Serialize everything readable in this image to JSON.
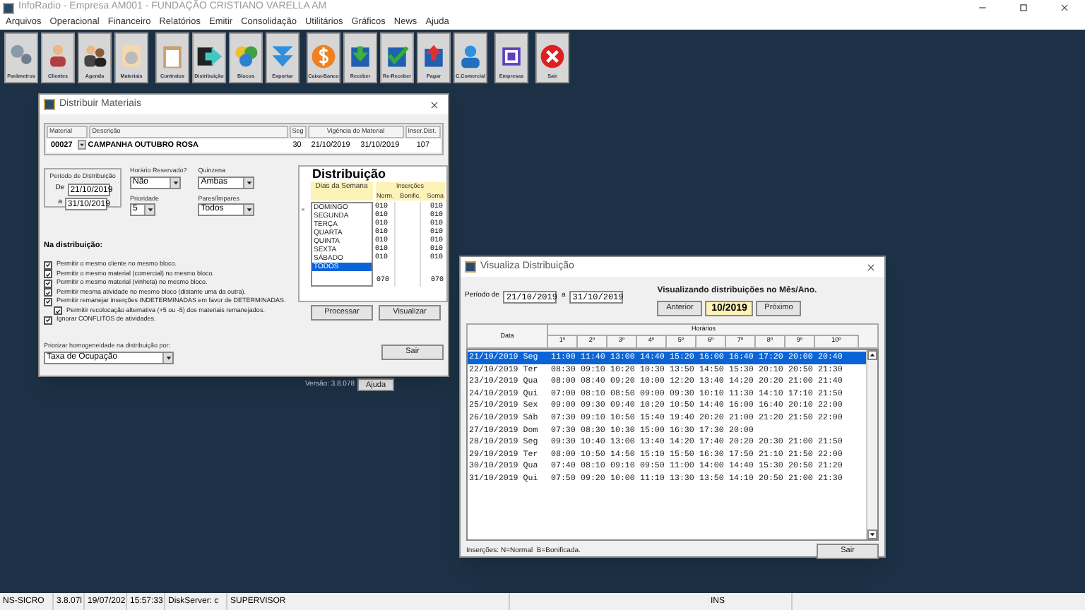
{
  "window": {
    "title": "InfoRadio - Empresa AM001 - FUNDAÇÃO CRISTIANO VARELLA AM"
  },
  "menu": [
    "Arquivos",
    "Operacional",
    "Financeiro",
    "Relatórios",
    "Emitir",
    "Consolidação",
    "Utilitários",
    "Gráficos",
    "News",
    "Ajuda"
  ],
  "toolbar": [
    [
      "Parâmetros",
      "Clientes",
      "Agenda",
      "Materiais"
    ],
    [
      "Contratos",
      "Distribuição",
      "Blocos",
      "Exportar"
    ],
    [
      "Caixa-Banco",
      "Receber",
      "Re-Receber",
      "Pagar",
      "C.Comercial"
    ],
    [
      "Empresas"
    ],
    [
      "Sair"
    ]
  ],
  "distribuir": {
    "title": "Distribuir Materiais",
    "header": {
      "labels": [
        "Material",
        "Descrição",
        "Seg",
        "Vigência do Material",
        "Inser.Dist."
      ],
      "material": "00027",
      "descricao": "CAMPANHA OUTUBRO ROSA",
      "seg": "30",
      "inicio": "21/10/2019",
      "fim": "31/10/2019",
      "inser": "107"
    },
    "periodo": {
      "title": "Período de Distribuição",
      "de_label": "De",
      "de": "21/10/2019",
      "a_label": "a",
      "a": "31/10/2019"
    },
    "selects": [
      {
        "label": "Horário Reservado?",
        "value": "Não"
      },
      {
        "label": "Quinzena",
        "value": "Ambas"
      },
      {
        "label": "Prioridade",
        "value": "5"
      },
      {
        "label": "Pares/Ímpares",
        "value": "Todos"
      }
    ],
    "na_title": "Na distribuição:",
    "options": [
      {
        "label": "Permitir o mesmo cliente no mesmo bloco.",
        "checked": true
      },
      {
        "label": "Permitir o mesmo material (comercial) no mesmo bloco.",
        "checked": true
      },
      {
        "label": "Permitir o mesmo material (vinheta) no mesmo bloco.",
        "checked": true
      },
      {
        "label": "Permitir mesma atividade no mesmo bloco (distante uma da outra).",
        "checked": true
      },
      {
        "label": "Permitir remanejar inserções INDETERMINADAS em favor de DETERMINADAS.",
        "checked": true,
        "children": [
          {
            "label": "Permitir recolocação alternativa (+5 ou -5) dos materiais remanejados.",
            "checked": true
          }
        ]
      },
      {
        "label": "Ignorar CONFLITOS de atividades.",
        "checked": true
      }
    ],
    "priorizar": {
      "label": "Priorizar homogeneidade na distribuição por:",
      "value": "Taxa de Ocupação"
    },
    "sair": "Sair",
    "distribuicao": {
      "title": "Distribuição",
      "mark": "×",
      "days_header": "Dias da Semana",
      "ins_header": "Inserções",
      "cols": [
        "Norm.",
        "Bonific.",
        "Soma"
      ],
      "days": [
        {
          "name": "DOMINGO",
          "norm": "010",
          "soma": "010",
          "selected": false
        },
        {
          "name": "SEGUNDA",
          "norm": "010",
          "soma": "010",
          "selected": false
        },
        {
          "name": "TERÇA",
          "norm": "010",
          "soma": "010",
          "selected": false
        },
        {
          "name": "QUARTA",
          "norm": "010",
          "soma": "010",
          "selected": false
        },
        {
          "name": "QUINTA",
          "norm": "010",
          "soma": "010",
          "selected": false
        },
        {
          "name": "SEXTA",
          "norm": "010",
          "soma": "010",
          "selected": false
        },
        {
          "name": "SÁBADO",
          "norm": "010",
          "soma": "010",
          "selected": false
        },
        {
          "name": "TODOS",
          "selected": true
        }
      ],
      "total_norm": "070",
      "total_soma": "070",
      "buttons": [
        "Processar",
        "Visualizar"
      ]
    }
  },
  "behind": {
    "version": "Versão: 3.8.078",
    "button": "Ajuda"
  },
  "visualiza": {
    "title": "Visualiza Distribuição",
    "periodo_label": "Período de",
    "de": "21/10/2019",
    "a_label": "a",
    "a": "31/10/2019",
    "heading": "Visualizando distribuições no Mês/Ano.",
    "prev": "Anterior",
    "month": "10/2019",
    "next": "Próximo",
    "data_header": "Data",
    "horarios_header": "Horários",
    "columns": [
      "1º",
      "2º",
      "3º",
      "4º",
      "5º",
      "6º",
      "7º",
      "8º",
      "9º",
      "10º"
    ],
    "rows": [
      {
        "date": "21/10/2019",
        "day": "Seg",
        "times": [
          "11:00",
          "11:40",
          "13:00",
          "14:40",
          "15:20",
          "16:00",
          "16:40",
          "17:20",
          "20:00",
          "20:40"
        ],
        "selected": true
      },
      {
        "date": "22/10/2019",
        "day": "Ter",
        "times": [
          "08:30",
          "09:10",
          "10:20",
          "10:30",
          "13:50",
          "14:50",
          "15:30",
          "20:10",
          "20:50",
          "21:30"
        ],
        "selected": false
      },
      {
        "date": "23/10/2019",
        "day": "Qua",
        "times": [
          "08:00",
          "08:40",
          "09:20",
          "10:00",
          "12:20",
          "13:40",
          "14:20",
          "20:20",
          "21:00",
          "21:40"
        ],
        "selected": false
      },
      {
        "date": "24/10/2019",
        "day": "Qui",
        "times": [
          "07:00",
          "08:10",
          "08:50",
          "09:00",
          "09:30",
          "10:10",
          "11:30",
          "14:10",
          "17:10",
          "21:50"
        ],
        "selected": false
      },
      {
        "date": "25/10/2019",
        "day": "Sex",
        "times": [
          "09:00",
          "09:30",
          "09:40",
          "10:20",
          "10:50",
          "14:40",
          "16:00",
          "16:40",
          "20:10",
          "22:00"
        ],
        "selected": false
      },
      {
        "date": "26/10/2019",
        "day": "Sáb",
        "times": [
          "07:30",
          "09:10",
          "10:50",
          "15:40",
          "19:40",
          "20:20",
          "21:00",
          "21:20",
          "21:50",
          "22:00"
        ],
        "selected": false
      },
      {
        "date": "27/10/2019",
        "day": "Dom",
        "times": [
          "07:30",
          "08:30",
          "10:30",
          "15:00",
          "16:30",
          "17:30",
          "20:00"
        ],
        "selected": false
      },
      {
        "date": "28/10/2019",
        "day": "Seg",
        "times": [
          "09:30",
          "10:40",
          "13:00",
          "13:40",
          "14:20",
          "17:40",
          "20:20",
          "20:30",
          "21:00",
          "21:50"
        ],
        "selected": false
      },
      {
        "date": "29/10/2019",
        "day": "Ter",
        "times": [
          "08:00",
          "10:50",
          "14:50",
          "15:10",
          "15:50",
          "16:30",
          "17:50",
          "21:10",
          "21:50",
          "22:00"
        ],
        "selected": false
      },
      {
        "date": "30/10/2019",
        "day": "Qua",
        "times": [
          "07:40",
          "08:10",
          "09:10",
          "09:50",
          "11:00",
          "14:00",
          "14:40",
          "15:30",
          "20:50",
          "21:20"
        ],
        "selected": false
      },
      {
        "date": "31/10/2019",
        "day": "Qui",
        "times": [
          "07:50",
          "09:20",
          "10:00",
          "11:10",
          "13:30",
          "13:50",
          "14:10",
          "20:50",
          "21:00",
          "21:30"
        ],
        "selected": false
      }
    ],
    "legend": "Inserções: N=Normal  B=Bonificada.",
    "sair": "Sair"
  },
  "status_bar": [
    "NS-SICRO",
    "3.8.07l",
    "19/07/202",
    "15:57:33",
    "DiskServer: c",
    "SUPERVISOR",
    "INS"
  ]
}
